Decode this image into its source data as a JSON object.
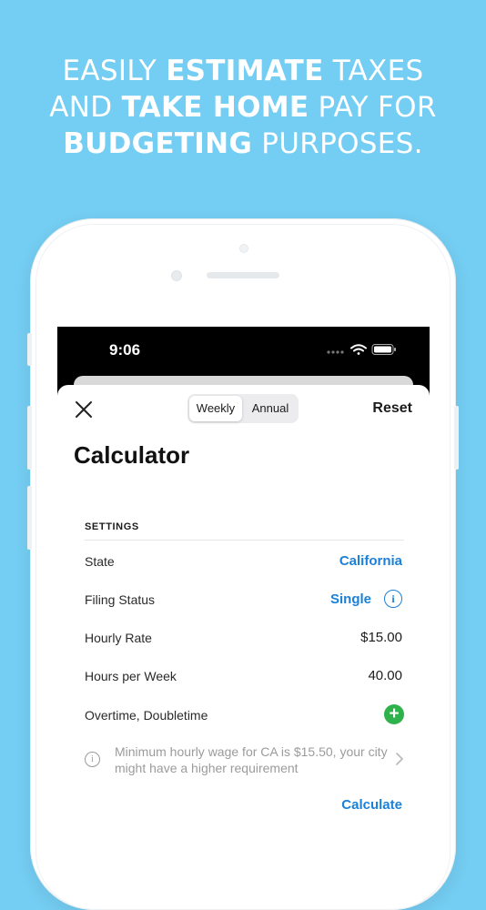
{
  "headline": {
    "line1": [
      {
        "text": "EASILY ",
        "bold": false
      },
      {
        "text": "ESTIMATE",
        "bold": true
      },
      {
        "text": " TAXES",
        "bold": false
      }
    ],
    "line2": [
      {
        "text": "AND ",
        "bold": false
      },
      {
        "text": "TAKE HOME",
        "bold": true
      },
      {
        "text": " PAY FOR",
        "bold": false
      }
    ],
    "line3": [
      {
        "text": "BUDGETING",
        "bold": true
      },
      {
        "text": " PURPOSES.",
        "bold": false
      }
    ]
  },
  "status_bar": {
    "time": "9:06",
    "icons": [
      "signal-icon",
      "wifi-icon",
      "battery-icon"
    ]
  },
  "header": {
    "close_icon": "close-icon",
    "segments": [
      "Weekly",
      "Annual"
    ],
    "selected_segment": "Weekly",
    "reset_label": "Reset"
  },
  "page_title": "Calculator",
  "settings": {
    "section_label": "SETTINGS",
    "rows": [
      {
        "label": "State",
        "value": "California",
        "link": true
      },
      {
        "label": "Filing Status",
        "value": "Single",
        "link": true,
        "icon": "info-icon"
      },
      {
        "label": "Hourly Rate",
        "value": "$15.00",
        "link": false
      },
      {
        "label": "Hours per Week",
        "value": "40.00",
        "link": false
      },
      {
        "label": "Overtime, Doubletime",
        "value": "",
        "icon": "plus-icon"
      }
    ]
  },
  "note": {
    "text": "Minimum hourly wage for CA is $15.50, your city might have a higher requirement",
    "icon": "info-icon",
    "chevron": "chevron-right-icon"
  },
  "calculate_label": "Calculate",
  "colors": {
    "background": "#74cdf2",
    "accent": "#1b80d8",
    "plus": "#2fb14c"
  }
}
